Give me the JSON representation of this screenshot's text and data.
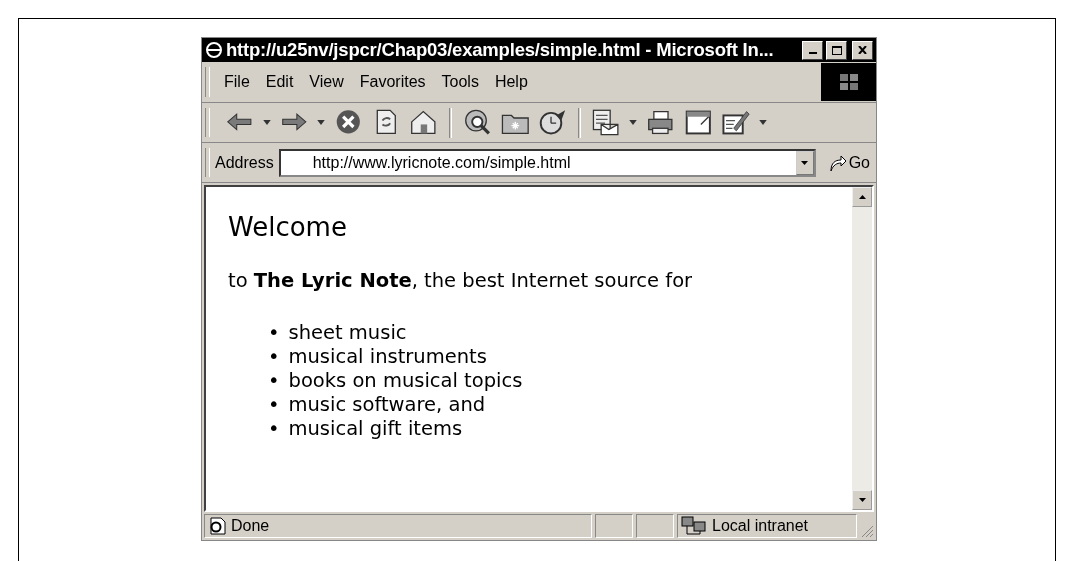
{
  "window": {
    "title": "http://u25nv/jspcr/Chap03/examples/simple.html - Microsoft In..."
  },
  "menu": [
    {
      "label": "File"
    },
    {
      "label": "Edit"
    },
    {
      "label": "View"
    },
    {
      "label": "Favorites"
    },
    {
      "label": "Tools"
    },
    {
      "label": "Help"
    }
  ],
  "address": {
    "label": "Address",
    "value": "http://www.lyricnote.com/simple.html",
    "go": "Go"
  },
  "page": {
    "heading": "Welcome",
    "intro": "to **The Lyric Note**, the best Internet source for",
    "bullet": "•",
    "items": [
      "sheet music",
      "musical instruments",
      "books on musical topics",
      "music software, and",
      "musical gift items"
    ]
  },
  "status_bar": {
    "text": "Done",
    "zone": "Local intranet"
  }
}
